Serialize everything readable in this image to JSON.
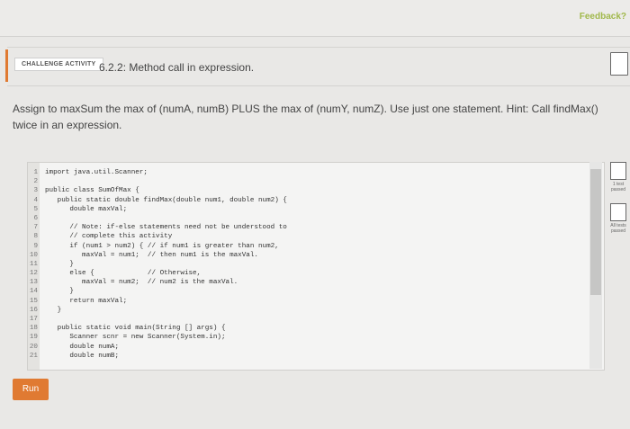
{
  "feedback_label": "Feedback?",
  "activity": {
    "badge": "CHALLENGE ACTIVITY",
    "title": "6.2.2: Method call in expression."
  },
  "instructions": "Assign to maxSum the max of (numA, numB) PLUS the max of (numY, numZ). Use just one statement. Hint: Call findMax() twice in an expression.",
  "code_lines": [
    {
      "n": "1",
      "text": "import java.util.Scanner;"
    },
    {
      "n": "2",
      "text": ""
    },
    {
      "n": "3",
      "text": "public class SumOfMax {"
    },
    {
      "n": "4",
      "text": "   public static double findMax(double num1, double num2) {"
    },
    {
      "n": "5",
      "text": "      double maxVal;"
    },
    {
      "n": "6",
      "text": ""
    },
    {
      "n": "7",
      "text": "      // Note: if-else statements need not be understood to"
    },
    {
      "n": "8",
      "text": "      // complete this activity"
    },
    {
      "n": "9",
      "text": "      if (num1 > num2) { // if num1 is greater than num2,"
    },
    {
      "n": "10",
      "text": "         maxVal = num1;  // then num1 is the maxVal."
    },
    {
      "n": "11",
      "text": "      }"
    },
    {
      "n": "12",
      "text": "      else {             // Otherwise,"
    },
    {
      "n": "13",
      "text": "         maxVal = num2;  // num2 is the maxVal."
    },
    {
      "n": "14",
      "text": "      }"
    },
    {
      "n": "15",
      "text": "      return maxVal;"
    },
    {
      "n": "16",
      "text": "   }"
    },
    {
      "n": "17",
      "text": ""
    },
    {
      "n": "18",
      "text": "   public static void main(String [] args) {"
    },
    {
      "n": "19",
      "text": "      Scanner scnr = new Scanner(System.in);"
    },
    {
      "n": "20",
      "text": "      double numA;"
    },
    {
      "n": "21",
      "text": "      double numB;"
    }
  ],
  "tests": [
    {
      "label": "1 test passed"
    },
    {
      "label": "All tests passed"
    }
  ],
  "run_label": "Run",
  "colors": {
    "accent": "#e07a32",
    "feedback": "#a0b84a"
  }
}
